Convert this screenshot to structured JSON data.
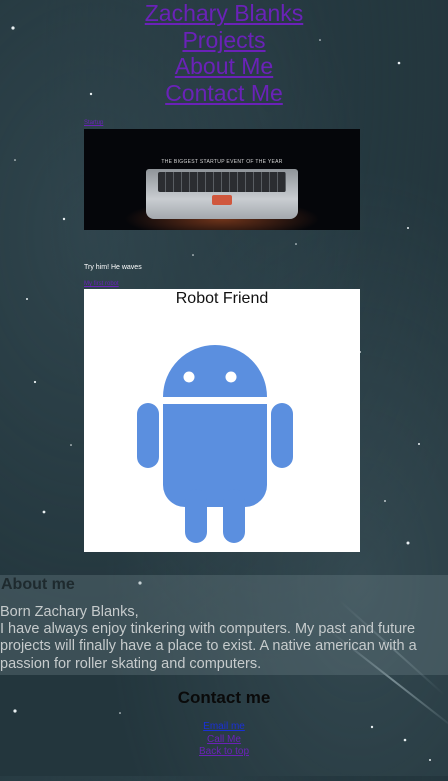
{
  "nav": {
    "items": [
      "Zachary Blanks",
      "Projects",
      "About Me",
      "Contact Me"
    ]
  },
  "projects": {
    "startup_link": "Startup",
    "startup_banner": "THE BIGGEST STARTUP EVENT OF THE YEAR",
    "robot_caption": "Try him! He waves",
    "robot_link": "My first robot",
    "robot_title": "Robot Friend"
  },
  "about": {
    "heading": "About me",
    "body": "Born Zachary Blanks,\nI have always enjoy tinkering with computers. My past and future projects will finally have a place to exist. A native american with a passion for roller skating and computers."
  },
  "contact": {
    "heading": "Contact me",
    "links": [
      "Email me",
      "Call Me",
      "Back to top"
    ]
  },
  "colors": {
    "link": "#6a22b8",
    "robot_green": "#5b8fdf",
    "background": "#23363d"
  }
}
